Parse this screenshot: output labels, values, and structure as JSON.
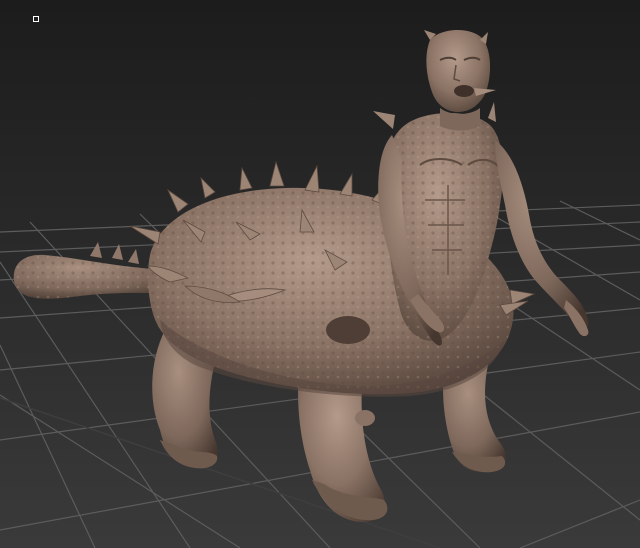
{
  "viewport": {
    "background_top": "#1f1f1f",
    "background_bottom": "#3a3a3a",
    "grid_color": "#5a5a5a",
    "grid_axis_color": "#3f3f3f",
    "model_color": "#8a7264",
    "model_shadow": "#4e3e35",
    "model_highlight": "#b39a8a"
  },
  "icons": {
    "corner_marker": "small-square-icon"
  }
}
